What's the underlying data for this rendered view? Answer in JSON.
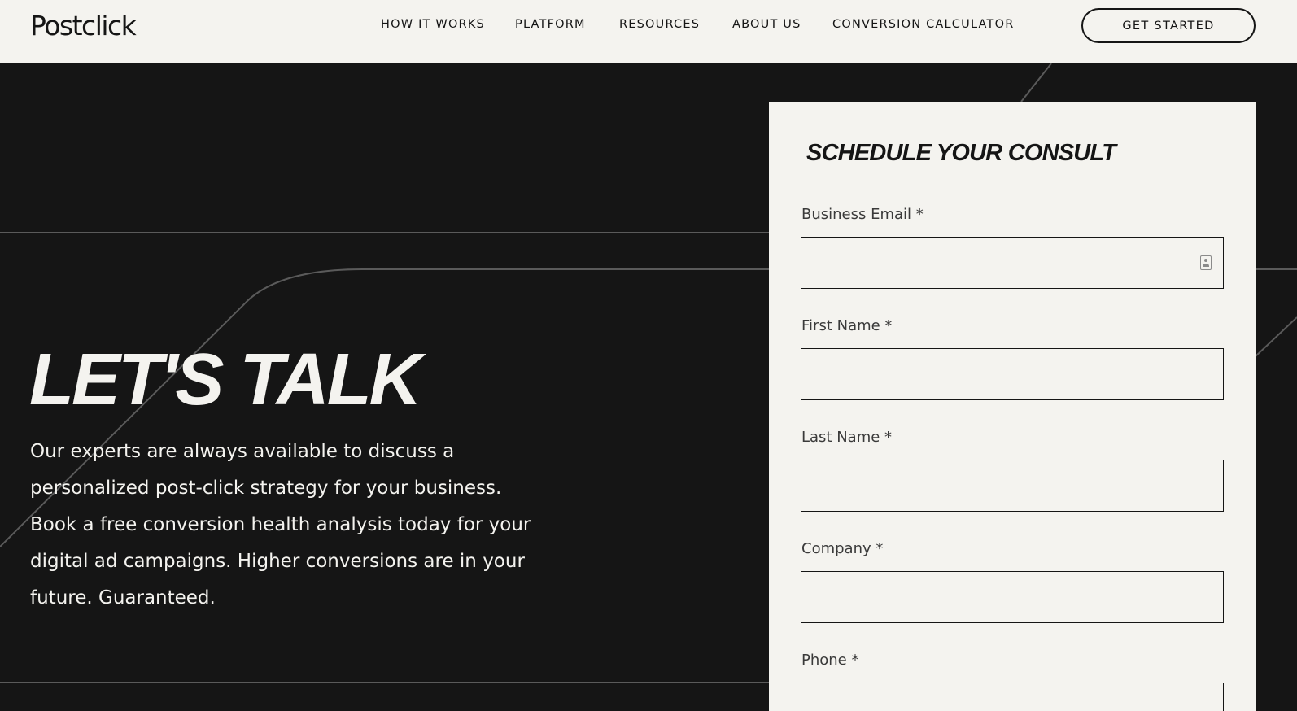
{
  "header": {
    "logo": "Postclick",
    "nav": [
      {
        "label": "HOW IT WORKS"
      },
      {
        "label": "PLATFORM"
      },
      {
        "label": "RESOURCES"
      },
      {
        "label": "ABOUT US"
      },
      {
        "label": "CONVERSION CALCULATOR"
      }
    ],
    "cta_label": "GET STARTED"
  },
  "hero": {
    "title": "LET'S TALK",
    "body": "Our experts are always available to discuss a personalized post-click strategy for your business. Book a free conversion health analysis today for your digital ad campaigns. Higher conversions are in your future. Guaranteed."
  },
  "form": {
    "title": "SCHEDULE YOUR CONSULT",
    "fields": [
      {
        "label": "Business Email *",
        "value": "",
        "icon": "contact-card-icon"
      },
      {
        "label": "First Name *",
        "value": ""
      },
      {
        "label": "Last Name *",
        "value": ""
      },
      {
        "label": "Company *",
        "value": ""
      },
      {
        "label": "Phone *",
        "value": ""
      }
    ]
  },
  "colors": {
    "background": "#151515",
    "light": "#f4f3ef",
    "line": "#5a5a5a"
  }
}
